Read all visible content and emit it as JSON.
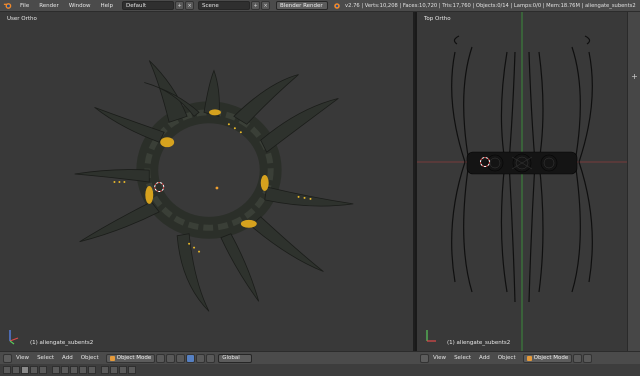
{
  "topbar": {
    "menus": [
      "File",
      "Render",
      "Window",
      "Help"
    ],
    "layout": "Default",
    "scene": "Scene",
    "engine": "Blender Render",
    "stats": "v2.76 | Verts:10,208 | Faces:10,720 | Tris:17,760 | Objects:0/14 | Lamps:0/0 | Mem:18.76M | aliengate_subents2"
  },
  "viewports": {
    "left": {
      "label": "User Ortho",
      "object": "(1) aliengate_subents2"
    },
    "right": {
      "label": "Top Ortho",
      "object": "(1) aliengate_subents2"
    }
  },
  "bottombar": {
    "left": {
      "menus": [
        "View",
        "Select",
        "Add",
        "Object"
      ],
      "mode": "Object Mode",
      "orientation": "Global"
    },
    "right": {
      "menus": [
        "View",
        "Select",
        "Add",
        "Object"
      ],
      "mode": "Object Mode"
    }
  },
  "colors": {
    "accent_orange": "#e69a3a",
    "active_blue": "#5680c2",
    "grid_green": "#3c8c3c",
    "grid_red": "#8c3c3c"
  }
}
